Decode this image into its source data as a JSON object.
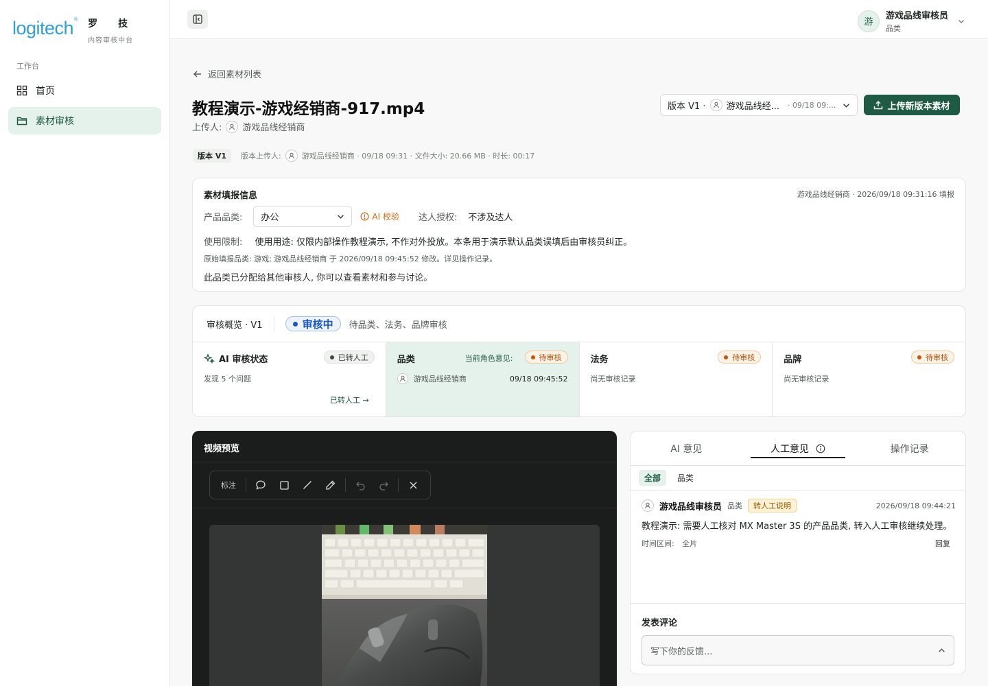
{
  "brand": {
    "logo_word": "logitech",
    "logo_mark": "®",
    "name_cn": "罗技",
    "subtitle": "内容审核中台"
  },
  "sidebar": {
    "section": "工作台",
    "items": [
      {
        "label": "首页",
        "icon": "grid-icon"
      },
      {
        "label": "素材审核",
        "icon": "folder-icon"
      }
    ]
  },
  "topbar": {
    "user_avatar": "游",
    "user_name": "游戏品线审核员",
    "user_role": "品类"
  },
  "header": {
    "back_label": "返回素材列表",
    "title": "教程演示-游戏经销商-917.mp4",
    "uploader_label": "上传人:",
    "uploader_name": "游戏品线经销商",
    "version_select": {
      "version": "版本 V1 ·",
      "user": "游戏品线经...",
      "date": "· 09/18 09:..."
    },
    "upload_button": "上传新版本素材",
    "version_badge": "版本 V1",
    "version_meta_label": "版本上传人:",
    "version_meta_rest": "游戏品线经销商 · 09/18 09:31 · 文件大小: 20.66 MB · 时长: 00:17"
  },
  "info": {
    "title": "素材填报信息",
    "stamp": "游戏品线经销商 · 2026/09/18 09:31:16 填报",
    "category_label": "产品品类:",
    "category_value": "办公",
    "ai_check": "AI 校验",
    "talent_label": "达人授权:",
    "talent_value": "不涉及达人",
    "usage_label": "使用限制:",
    "usage_value": "使用用途: 仅限内部操作教程演示, 不作对外投放。本条用于演示默认品类误填后由审核员纠正。",
    "original_note": "原始填报品类: 游戏; 游戏品线经销商 于 2026/09/18 09:45:52 修改。详见操作记录。",
    "assigned_note": "此品类已分配给其他审核人, 你可以查看素材和参与讨论。"
  },
  "overview": {
    "title": "审核概览 · V1",
    "status": "审核中",
    "pending_note": "待品类、法务、品牌审核",
    "ai": {
      "title": "AI 审核状态",
      "badge": "已转人工",
      "sub": "发现 5 个问题",
      "link": "已转人工 →"
    },
    "category": {
      "title": "品类",
      "role_opinion": "当前角色意见:",
      "badge": "待审核",
      "reviewer": "游戏品线经销商",
      "time": "09/18 09:45:52"
    },
    "legal": {
      "title": "法务",
      "badge": "待审核",
      "sub": "尚无审核记录"
    },
    "brand": {
      "title": "品牌",
      "badge": "待审核",
      "sub": "尚无审核记录"
    }
  },
  "video": {
    "title": "视频预览",
    "annotate_label": "标注",
    "tools": [
      "comment-icon",
      "rectangle-icon",
      "line-icon",
      "pencil-icon",
      "undo-icon",
      "redo-icon",
      "close-icon"
    ]
  },
  "opinions": {
    "tabs": [
      "AI 意见",
      "人工意见",
      "操作记录"
    ],
    "active_tab": "人工意见",
    "filters": [
      "全部",
      "品类"
    ],
    "comment": {
      "author": "游戏品线审核员",
      "category": "品类",
      "tag": "转人工说明",
      "time": "2026/09/18 09:44:21",
      "body": "教程演示: 需要人工核对 MX Master 3S 的产品品类, 转入人工审核继续处理。",
      "range_label": "时间区间:",
      "range_value": "全片",
      "reply": "回复"
    },
    "post_title": "发表评论",
    "post_placeholder": "写下你的反馈..."
  },
  "colors": {
    "brand_green": "#1e5a44",
    "logo_blue": "#2f9ed8",
    "status_blue": "#1b57c7",
    "pending_orange": "#c2570c"
  }
}
